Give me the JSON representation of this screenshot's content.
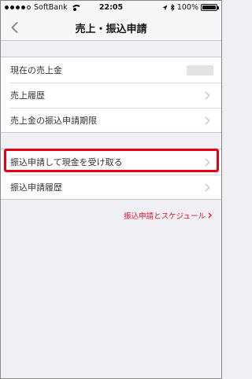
{
  "status_bar": {
    "carrier": "SoftBank",
    "time": "22:05",
    "battery": "100%",
    "battery_level": 1.0,
    "signal_bars_filled": 4,
    "signal_bars_total": 5,
    "icons": [
      "signal-icon",
      "wifi-icon",
      "location-arrow-icon",
      "bluetooth-icon",
      "battery-icon"
    ]
  },
  "nav": {
    "title": "売上・振込申請",
    "back_icon": "chevron-left-icon"
  },
  "group1": {
    "rows": [
      {
        "label": "現在の売上金"
      },
      {
        "label": "売上履歴"
      },
      {
        "label": "売上金の振込申請期限"
      }
    ]
  },
  "group2": {
    "rows": [
      {
        "label": "振込申請して現金を受け取る"
      },
      {
        "label": "振込申請履歴"
      }
    ]
  },
  "schedule_link": {
    "label": "振込申請とスケジュール"
  },
  "colors": {
    "accent_red": "#e0162b",
    "highlight_red": "#e60012",
    "background": "#efeff4",
    "chevron_gray": "#c7c7cc"
  }
}
